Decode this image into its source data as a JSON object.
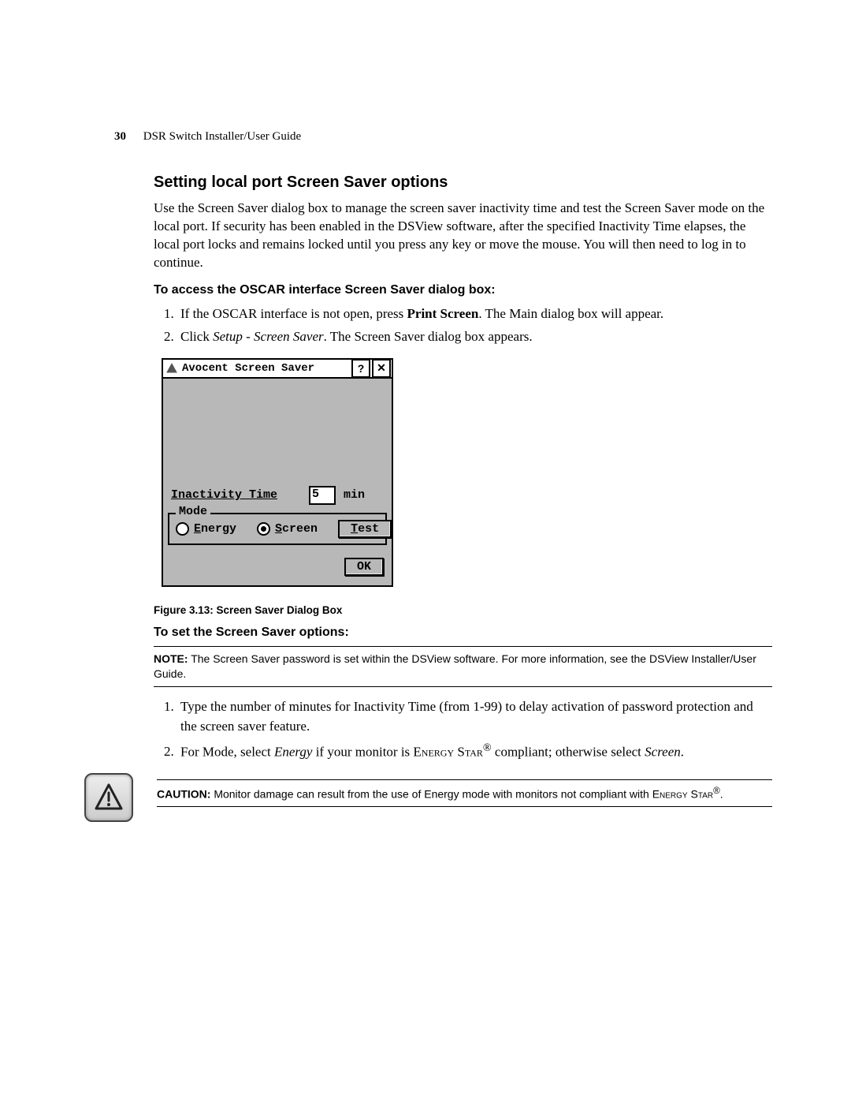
{
  "header": {
    "page_number": "30",
    "doc_title": "DSR Switch Installer/User Guide"
  },
  "section": {
    "title": "Setting local port Screen Saver options",
    "intro": "Use the Screen Saver dialog box to manage the screen saver inactivity time and test the Screen Saver mode on the local port. If security has been enabled in the DSView software, after the specified Inactivity Time elapses, the local port locks and remains locked until you press any key or move the mouse. You will then need to log in to continue."
  },
  "access": {
    "heading": "To access the OSCAR interface Screen Saver dialog box:",
    "steps": [
      {
        "pre": "If the OSCAR interface is not open, press ",
        "bold": "Print Screen",
        "post": ". The Main dialog box will appear."
      },
      {
        "pre": "Click ",
        "italic": "Setup - Screen Saver",
        "post": ". The Screen Saver dialog box appears."
      }
    ]
  },
  "dialog": {
    "title": "Avocent Screen Saver",
    "help_btn": "?",
    "close_btn": "✕",
    "inactivity_label": "Inactivity Time",
    "inactivity_underline_char": "I",
    "inactivity_value": "5",
    "inactivity_unit": "min",
    "mode_legend": "Mode",
    "energy_label": "Energy",
    "energy_underline_char": "E",
    "screen_label": "Screen",
    "screen_underline_char": "S",
    "screen_selected": true,
    "test_btn": "Test",
    "test_underline_char": "T",
    "ok_btn": "OK"
  },
  "figure": {
    "caption": "Figure 3.13: Screen Saver Dialog Box"
  },
  "set": {
    "heading": "To set the Screen Saver options:",
    "note_lead": "NOTE:",
    "note_text": " The Screen Saver password is set within the DSView software. For more information, see the DSView Installer/User Guide.",
    "steps": [
      {
        "text": "Type the number of minutes for Inactivity Time (from 1-99) to delay activation of password protection and the screen saver feature."
      },
      {
        "pre": "For Mode, select ",
        "italic1": "Energy",
        "mid": " if your monitor is ",
        "smallcaps": "Energy Star",
        "reg": "®",
        "post1": " compliant; otherwise select ",
        "italic2": "Screen",
        "post2": "."
      }
    ]
  },
  "caution": {
    "lead": "CAUTION:",
    "text": " Monitor damage can result from the use of Energy mode with monitors not compliant with ",
    "smallcaps": "Energy Star",
    "reg": "®",
    "end": "."
  }
}
